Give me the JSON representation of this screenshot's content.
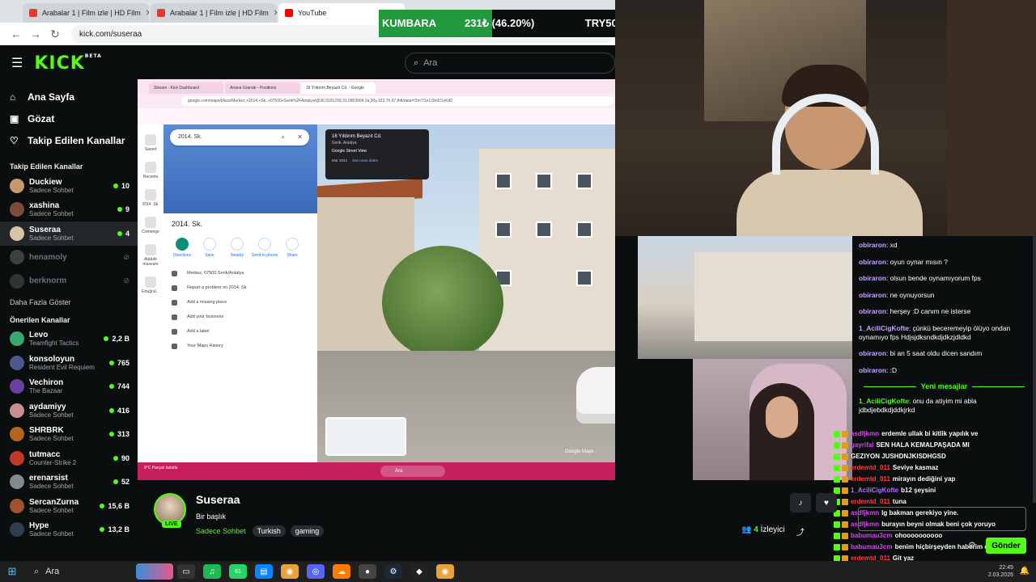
{
  "browser": {
    "tabs": [
      {
        "label": "Arabalar 1 | Film izle | HD Film",
        "icon": "red-favicon-icon"
      },
      {
        "label": "Arabalar 1 | Film izle | HD Film",
        "icon": "red-favicon-icon"
      },
      {
        "label": "YouTube",
        "icon": "youtube-icon"
      }
    ],
    "url": "kick.com/suseraa"
  },
  "kick": {
    "logo": "KICK",
    "logo_sup": "BETA",
    "search_placeholder": "Ara"
  },
  "sidebar": {
    "main_nav": [
      {
        "label": "Ana Sayfa",
        "icon": "home-icon"
      },
      {
        "label": "Gözat",
        "icon": "browse-icon"
      },
      {
        "label": "Takip Edilen Kanallar",
        "icon": "heart-icon"
      }
    ],
    "followed_title": "Takip Edilen Kanallar",
    "followed": [
      {
        "name": "Duckiew",
        "category": "Sadece Sohbet",
        "viewers": "10",
        "color": "#c49a6c"
      },
      {
        "name": "xashina",
        "category": "Sadece Sohbet",
        "viewers": "9",
        "color": "#7a4a3a"
      },
      {
        "name": "Suseraa",
        "category": "Sadece Sohbet",
        "viewers": "4",
        "color": "#d9c3a8"
      },
      {
        "name": "henamoly",
        "category": "",
        "viewers": "",
        "color": "#8a8a8a"
      },
      {
        "name": "berknorm",
        "category": "",
        "viewers": "",
        "color": "#6a6a6a"
      }
    ],
    "show_more": "Daha Fazla Göster",
    "recommended_title": "Önerilen Kanallar",
    "recommended": [
      {
        "name": "Levo",
        "category": "Teamfight Tactics",
        "viewers": "2,2 B",
        "color": "#3aa76d"
      },
      {
        "name": "konsoloyun",
        "category": "Resident Evil Requiem",
        "viewers": "765",
        "color": "#4a5a8a"
      },
      {
        "name": "Vechiron",
        "category": "The Bazaar",
        "viewers": "744",
        "color": "#6b3fa0"
      },
      {
        "name": "aydamiyy",
        "category": "Sadece Sohbet",
        "viewers": "416",
        "color": "#c98f8f"
      },
      {
        "name": "SHRBRK",
        "category": "Sadece Sohbet",
        "viewers": "313",
        "color": "#b5651d"
      },
      {
        "name": "tutmacc",
        "category": "Counter-Strike 2",
        "viewers": "90",
        "color": "#c0392b"
      },
      {
        "name": "erenarsist",
        "category": "Sadece Sohbet",
        "viewers": "52",
        "color": "#7f8c8d"
      },
      {
        "name": "SercanZurna",
        "category": "Sadece Sohbet",
        "viewers": "15,6 B",
        "color": "#a0522d"
      },
      {
        "name": "Hype",
        "category": "Sadece Sohbet",
        "viewers": "13,2 B",
        "color": "#2c3e50"
      }
    ]
  },
  "stream_screen": {
    "inner_tabs": [
      "Stream - Kick Dashboard",
      "Ariana Grande - Positions",
      "16 Yıldırım Beyazıt Cd. - Google"
    ],
    "inner_url": "google.com/maps/place/Merkez,+2014.+Sk.,+07500+Serik%2FAntalya/@36.9191293,31.0903904,3a,90y,123.7h,97.84t/data=!3m7!1e1!3m5!1sKd0",
    "rail": [
      "Saved",
      "Recents",
      "2014. Sk.",
      "Comenge",
      "Atatürk museum",
      "Ertuğrul..."
    ],
    "panel_search": "2014. Sk.",
    "panel_title": "2014. Sk.",
    "actions": [
      "Directions",
      "Save",
      "Nearby",
      "Send to phone",
      "Share"
    ],
    "list": [
      "Merkez, 07500 Serik/Antalya",
      "Report a problem on 2014. Sk.",
      "Add a missing place",
      "Add your business",
      "Add a label",
      "Your Maps History"
    ],
    "sv_title": "16 Yıldırım Beyazıt Cd.",
    "sv_sub": "Serik, Antalya",
    "sv_brand": "Google Street View",
    "sv_date": "Mar 2024",
    "sv_more": "See more dates",
    "watermark": "Google Maps",
    "win_search": "Ara",
    "win_weather": "9°C Parçalı bulutlu"
  },
  "stream_info": {
    "name": "Suseraa",
    "title": "Bir başlık",
    "live": "LIVE",
    "category": "Sadece Sohbet",
    "tags": [
      "Turkish",
      "gaming"
    ],
    "viewers": "4",
    "viewers_label": "İzleyici"
  },
  "kumbara": {
    "label": "KUMBARA",
    "amount": "231₺ (46.20%)",
    "goal": "TRY500",
    "progress": 0.462
  },
  "chat": {
    "messages": [
      {
        "user": "obiraron",
        "text": "xd",
        "color": "purple"
      },
      {
        "user": "obiraron",
        "text": "oyun oynar mısın ?",
        "color": "purple"
      },
      {
        "user": "obiraron",
        "text": "olsun bende oynamıyorum fps",
        "color": "purple"
      },
      {
        "user": "obiraron",
        "text": "ne oynuyorsun",
        "color": "purple"
      },
      {
        "user": "obiraron",
        "text": "herşey :D canım ne isterse",
        "color": "purple"
      },
      {
        "user": "1_AciliCigKofte",
        "text": "çünkü beceremeyip ölüyo ondan oynamıyo fps Hdjsjdksndkdjdkzjdldkd",
        "color": "purple"
      },
      {
        "user": "obiraron",
        "text": "bi an 5 saat oldu dicen sandım",
        "color": "purple"
      },
      {
        "user": "obiraron",
        "text": ":D",
        "color": "purple"
      }
    ],
    "new_messages_label": "Yeni mesajlar",
    "after_new": [
      {
        "user": "1_AciliCigKofte",
        "text": "onu da atiyim mi abla jdbdjebdkdjddkjrkd",
        "color": "green"
      }
    ],
    "send_label": "Gönder"
  },
  "overlay_chat": [
    {
      "user": "asdfjkmn",
      "text": "erdemle ullak bi kitlik yapılık ve",
      "color": "purple"
    },
    {
      "user": "gayrifal",
      "text": "SEN HALA KEMALPAŞADA MI",
      "color": "purple"
    },
    {
      "user": "",
      "text": "GEZIYON JUSHDNJKISDHGSD",
      "color": "purple"
    },
    {
      "user": "erdemtd_011",
      "text": "Seviye kasmaz",
      "color": "red"
    },
    {
      "user": "erdemtd_011",
      "text": "mirayın dediğini yap",
      "color": "red"
    },
    {
      "user": "1_AciliCigKofte",
      "text": "b12 şeysini",
      "color": "violet"
    },
    {
      "user": "erdemtd_011",
      "text": "tuna",
      "color": "red"
    },
    {
      "user": "asdfjkmn",
      "text": "lg bakman gerekiyo yine.",
      "color": "purple"
    },
    {
      "user": "asdfjkmn",
      "text": "burayın beyni olmak beni çok yoruyo",
      "color": "purple"
    },
    {
      "user": "babumau3cm",
      "text": "ohoooooooooo",
      "color": "purple"
    },
    {
      "user": "babumau3cm",
      "text": "benim hiçbirşeyden haberim olmuyo",
      "color": "purple"
    },
    {
      "user": "erdemtd_011",
      "text": "Git yaz",
      "color": "red"
    },
    {
      "user": "erdemtd_011",
      "text": "o zaman",
      "color": "red"
    },
    {
      "user": "erdemtd_011",
      "text": "dangalak",
      "color": "red"
    },
    {
      "user": "asdfjkmn",
      "text": "ben artık akıl vermicem...",
      "color": "purple"
    }
  ],
  "taskbar": {
    "search": "Ara",
    "whatsapp_badge": "61",
    "time": "22:45",
    "date": "2.03.2026"
  },
  "colors": {
    "kick_green": "#53fc18",
    "bg": "#0b0e0f",
    "kumbara_fill": "#219a3e"
  }
}
